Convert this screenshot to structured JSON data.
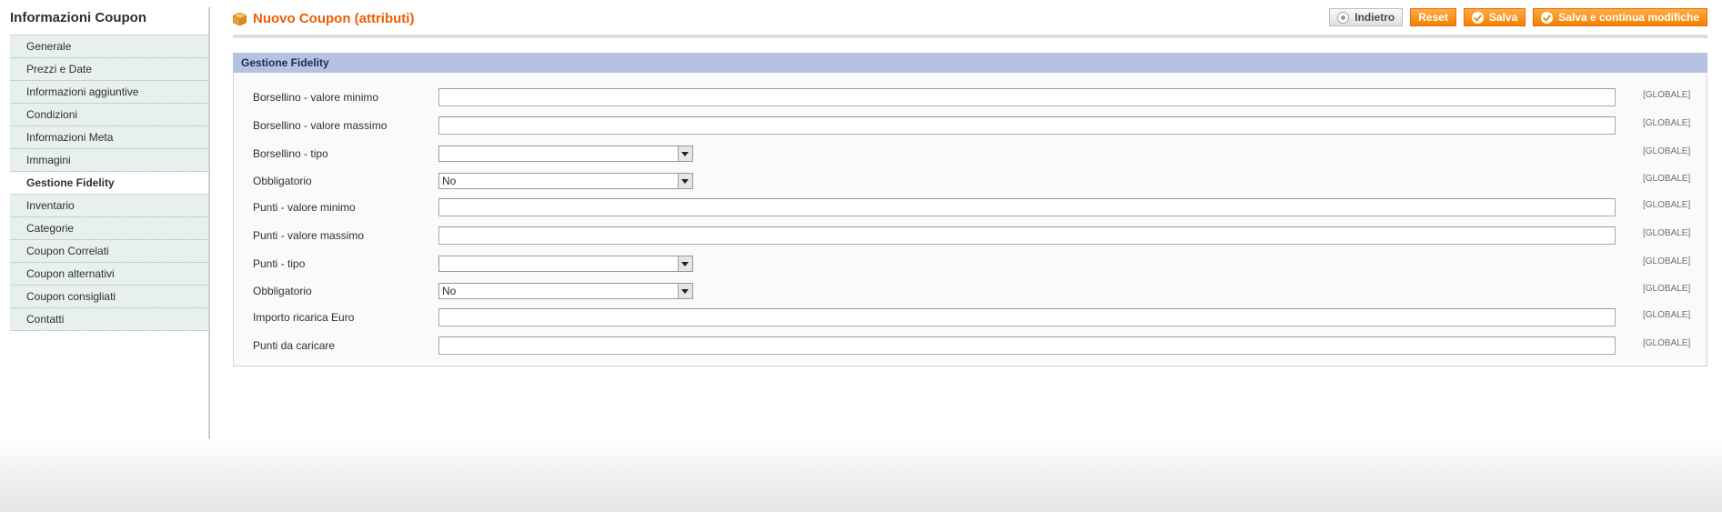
{
  "sidebar": {
    "title": "Informazioni Coupon",
    "tabs": [
      {
        "label": "Generale",
        "active": false
      },
      {
        "label": "Prezzi e Date",
        "active": false
      },
      {
        "label": "Informazioni aggiuntive",
        "active": false
      },
      {
        "label": "Condizioni",
        "active": false
      },
      {
        "label": "Informazioni Meta",
        "active": false
      },
      {
        "label": "Immagini",
        "active": false
      },
      {
        "label": "Gestione Fidelity",
        "active": true
      },
      {
        "label": "Inventario",
        "active": false
      },
      {
        "label": "Categorie",
        "active": false
      },
      {
        "label": "Coupon Correlati",
        "active": false
      },
      {
        "label": "Coupon alternativi",
        "active": false
      },
      {
        "label": "Coupon consigliati",
        "active": false
      },
      {
        "label": "Contatti",
        "active": false
      }
    ]
  },
  "header": {
    "title": "Nuovo Coupon (attributi)",
    "title_icon": "box-icon",
    "buttons": {
      "back": "Indietro",
      "reset": "Reset",
      "save": "Salva",
      "save_continue": "Salva e continua modifiche"
    }
  },
  "section": {
    "title": "Gestione Fidelity",
    "fields": [
      {
        "label": "Borsellino - valore minimo",
        "type": "text",
        "value": "",
        "scope": "[GLOBALE]"
      },
      {
        "label": "Borsellino - valore massimo",
        "type": "text",
        "value": "",
        "scope": "[GLOBALE]"
      },
      {
        "label": "Borsellino - tipo",
        "type": "select",
        "value": "",
        "scope": "[GLOBALE]"
      },
      {
        "label": "Obbligatorio",
        "type": "select",
        "value": "No",
        "scope": "[GLOBALE]"
      },
      {
        "label": "Punti - valore minimo",
        "type": "text",
        "value": "",
        "scope": "[GLOBALE]"
      },
      {
        "label": "Punti - valore massimo",
        "type": "text",
        "value": "",
        "scope": "[GLOBALE]"
      },
      {
        "label": "Punti - tipo",
        "type": "select",
        "value": "",
        "scope": "[GLOBALE]"
      },
      {
        "label": "Obbligatorio",
        "type": "select",
        "value": "No",
        "scope": "[GLOBALE]"
      },
      {
        "label": "Importo ricarica Euro",
        "type": "text",
        "value": "",
        "scope": "[GLOBALE]"
      },
      {
        "label": "Punti da caricare",
        "type": "text",
        "value": "",
        "scope": "[GLOBALE]"
      }
    ]
  },
  "colors": {
    "accent": "#eb5e00",
    "button": "#f18200",
    "section_header": "#b5c3e1",
    "tab_bg": "#e7efef"
  }
}
